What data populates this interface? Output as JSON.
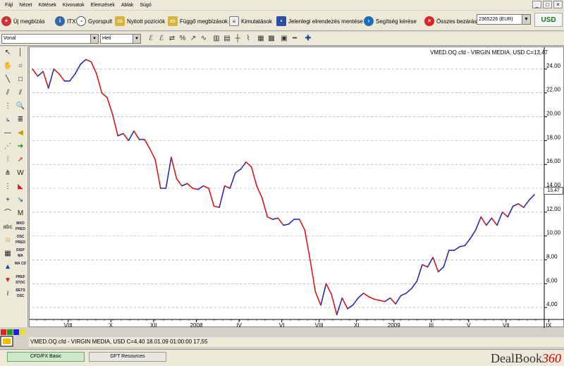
{
  "menu": [
    "Fájl",
    "Nézet",
    "Kötések",
    "Kivonatok",
    "Elemzések",
    "Ablak",
    "Súgó"
  ],
  "toolbar": {
    "new_order": "Új megbízás",
    "itx": "ITX",
    "quick_dash": "Gyorspult",
    "open_positions": "Nyitott pozíciók",
    "pending_orders": "Függő megbízások",
    "statements": "Kimutatások",
    "save_layout": "Jelenlegi elrendezés mentése",
    "help_request": "Segítség kérése",
    "close_all": "Összes bezárása",
    "account": "2365226 (EUR)",
    "currency": "USD"
  },
  "chart_toolbar": {
    "chart_type": "Vonal",
    "period": "Heti"
  },
  "chart_title": "VMED.OQ.cfd - VIRGIN MEDIA, USD C=13,47",
  "current_value": "13,47",
  "status_text": "VMED.OQ.cfd - VIRGIN MEDIA, USD C=4,40   18.01.09 01:00:00 17,55",
  "tabs": [
    "CFD/FX Basic",
    "GFT Resources"
  ],
  "logo": {
    "main": "DealBook",
    "num": "360"
  },
  "left_tool_labels": [
    "abc",
    "MKD PRED",
    "OSC PRED",
    "DISP MA",
    "MA CD",
    "PREF STOC",
    "BETS OSC"
  ],
  "colors": {
    "up": "#2a2ab8",
    "down": "#d81818",
    "grid": "#9a9a9a"
  },
  "chart_data": {
    "type": "line",
    "title": "VMED.OQ.cfd - VIRGIN MEDIA, USD C=13,47",
    "xlabel": "",
    "ylabel": "",
    "ylim": [
      3.0,
      25.0
    ],
    "y_ticks": [
      "4,00",
      "6,00",
      "8,00",
      "10,00",
      "12,00",
      "14,00",
      "16,00",
      "18,00",
      "20,00",
      "22,00",
      "24,00"
    ],
    "x_ticks": [
      "VIII",
      "X",
      "XII",
      "2008",
      "IV",
      "VI",
      "VIII",
      "XI",
      "2009",
      "III",
      "V",
      "VII",
      "IX"
    ],
    "y": [
      24.0,
      23.4,
      23.8,
      22.4,
      24.0,
      23.6,
      23.0,
      23.0,
      23.6,
      24.4,
      24.8,
      24.6,
      23.6,
      22.0,
      21.6,
      20.2,
      18.4,
      18.6,
      18.0,
      18.8,
      18.1,
      18.1,
      17.3,
      16.4,
      14.0,
      14.0,
      16.6,
      14.8,
      14.2,
      14.4,
      14.0,
      13.9,
      14.2,
      14.0,
      12.5,
      12.4,
      14.2,
      14.0,
      15.3,
      15.6,
      16.2,
      15.8,
      14.2,
      13.2,
      11.6,
      11.4,
      11.5,
      10.9,
      11.0,
      11.4,
      11.4,
      10.5,
      8.0,
      5.3,
      4.2,
      6.0,
      5.1,
      3.4,
      4.8,
      3.9,
      4.2,
      4.8,
      5.2,
      4.9,
      4.7,
      4.6,
      4.5,
      4.8,
      4.3,
      5.0,
      5.2,
      5.6,
      6.2,
      7.6,
      7.4,
      8.2,
      7.0,
      7.4,
      8.8,
      8.8,
      9.1,
      9.2,
      9.8,
      10.5,
      11.6,
      10.9,
      11.5,
      10.9,
      12.0,
      11.6,
      12.5,
      12.7,
      12.4,
      13.0,
      13.47
    ]
  }
}
